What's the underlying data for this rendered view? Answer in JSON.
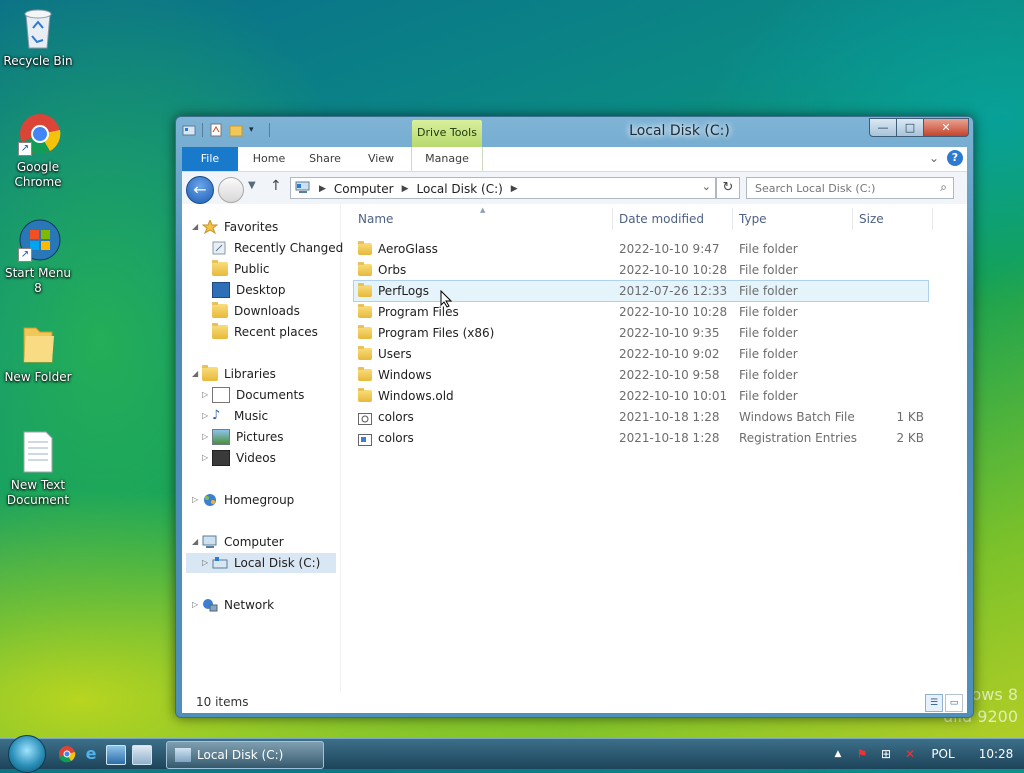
{
  "desktop": {
    "icons": [
      {
        "label": "Recycle Bin"
      },
      {
        "label": "Google Chrome"
      },
      {
        "label": "Start Menu 8"
      },
      {
        "label": "New Folder"
      },
      {
        "label": "New Text Document"
      }
    ],
    "watermark_line1": "ows 8",
    "watermark_line2": "uild 9200"
  },
  "window": {
    "title": "Local Disk (C:)",
    "contextual_tab_group": "Drive Tools",
    "buttons": {
      "minimize": "—",
      "maximize": "□",
      "close": "✕"
    }
  },
  "ribbon": {
    "tabs": [
      "File",
      "Home",
      "Share",
      "View",
      "Manage"
    ],
    "expand_icon": "chevron-down-icon",
    "help_label": "?"
  },
  "navbar": {
    "breadcrumb": [
      "Computer",
      "Local Disk (C:)"
    ],
    "search_placeholder": "Search Local Disk (C:)"
  },
  "navpane": {
    "favorites": {
      "label": "Favorites",
      "items": [
        "Recently Changed",
        "Public",
        "Desktop",
        "Downloads",
        "Recent places"
      ]
    },
    "libraries": {
      "label": "Libraries",
      "items": [
        "Documents",
        "Music",
        "Pictures",
        "Videos"
      ]
    },
    "homegroup": "Homegroup",
    "computer": {
      "label": "Computer",
      "items": [
        "Local Disk (C:)"
      ]
    },
    "network": "Network"
  },
  "files": {
    "columns": {
      "name": "Name",
      "date": "Date modified",
      "type": "Type",
      "size": "Size"
    },
    "rows": [
      {
        "name": "AeroGlass",
        "date": "2022-10-10 9:47",
        "type": "File folder",
        "size": ""
      },
      {
        "name": "Orbs",
        "date": "2022-10-10 10:28",
        "type": "File folder",
        "size": ""
      },
      {
        "name": "PerfLogs",
        "date": "2012-07-26 12:33",
        "type": "File folder",
        "size": ""
      },
      {
        "name": "Program Files",
        "date": "2022-10-10 10:28",
        "type": "File folder",
        "size": ""
      },
      {
        "name": "Program Files (x86)",
        "date": "2022-10-10 9:35",
        "type": "File folder",
        "size": ""
      },
      {
        "name": "Users",
        "date": "2022-10-10 9:02",
        "type": "File folder",
        "size": ""
      },
      {
        "name": "Windows",
        "date": "2022-10-10 9:58",
        "type": "File folder",
        "size": ""
      },
      {
        "name": "Windows.old",
        "date": "2022-10-10 10:01",
        "type": "File folder",
        "size": ""
      },
      {
        "name": "colors",
        "date": "2021-10-18 1:28",
        "type": "Windows Batch File",
        "size": "1 KB"
      },
      {
        "name": "colors",
        "date": "2021-10-18 1:28",
        "type": "Registration Entries",
        "size": "2 KB"
      }
    ]
  },
  "status": {
    "item_count": "10 items"
  },
  "taskbar": {
    "task_label": "Local Disk (C:)",
    "language": "POL",
    "clock": "10:28"
  }
}
